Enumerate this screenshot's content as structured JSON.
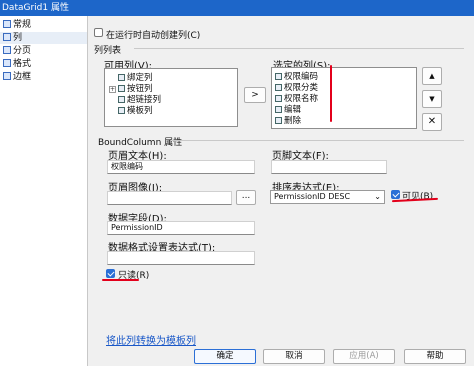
{
  "window": {
    "title": "DataGrid1 属性"
  },
  "sidebar": {
    "items": [
      {
        "label": "常规"
      },
      {
        "label": "列"
      },
      {
        "label": "分页"
      },
      {
        "label": "格式"
      },
      {
        "label": "边框"
      }
    ],
    "selected": "列"
  },
  "columns_page": {
    "auto_generate": {
      "label": "在运行时自动创建列(C)",
      "checked": false
    },
    "list_group_label": "列列表",
    "available": {
      "label": "可用列(V):",
      "items": [
        {
          "label": "绑定列",
          "expandable": false
        },
        {
          "label": "按钮列",
          "expandable": true
        },
        {
          "label": "超链接列",
          "expandable": false
        },
        {
          "label": "模板列",
          "expandable": false
        }
      ]
    },
    "add_button_label": ">",
    "selected": {
      "label": "选定的列(S):",
      "items": [
        {
          "label": "权限编码"
        },
        {
          "label": "权限分类"
        },
        {
          "label": "权限名称"
        },
        {
          "label": "编辑"
        },
        {
          "label": "删除"
        }
      ]
    },
    "move_up_symbol": "▲",
    "move_down_symbol": "▼",
    "delete_symbol": "✕",
    "boundcolumn_group_label": "BoundColumn 属性",
    "header_text": {
      "label": "页眉文本(H):",
      "value": "权限编码"
    },
    "footer_text": {
      "label": "页脚文本(F):",
      "value": ""
    },
    "header_image": {
      "label": "页眉图像(I):",
      "value": "",
      "browse_label": "..."
    },
    "sort_expression": {
      "label": "排序表达式(E):",
      "value": "PermissionID DESC"
    },
    "visible": {
      "label": "可见(B)",
      "checked": true
    },
    "data_field": {
      "label": "数据字段(D):",
      "value": "PermissionID"
    },
    "format_expression": {
      "label": "数据格式设置表达式(T):",
      "value": ""
    },
    "readonly": {
      "label": "只读(R)",
      "checked": true
    },
    "convert_link": "将此列转换为模板列"
  },
  "footer": {
    "ok": "确定",
    "cancel": "取消",
    "apply": "应用(A)",
    "help": "帮助",
    "apply_enabled": false
  },
  "colors": {
    "titlebar": "#1d66c9",
    "accent": "#2b6fd6",
    "annotation_red": "#e3001b",
    "link": "#1a58c8"
  }
}
